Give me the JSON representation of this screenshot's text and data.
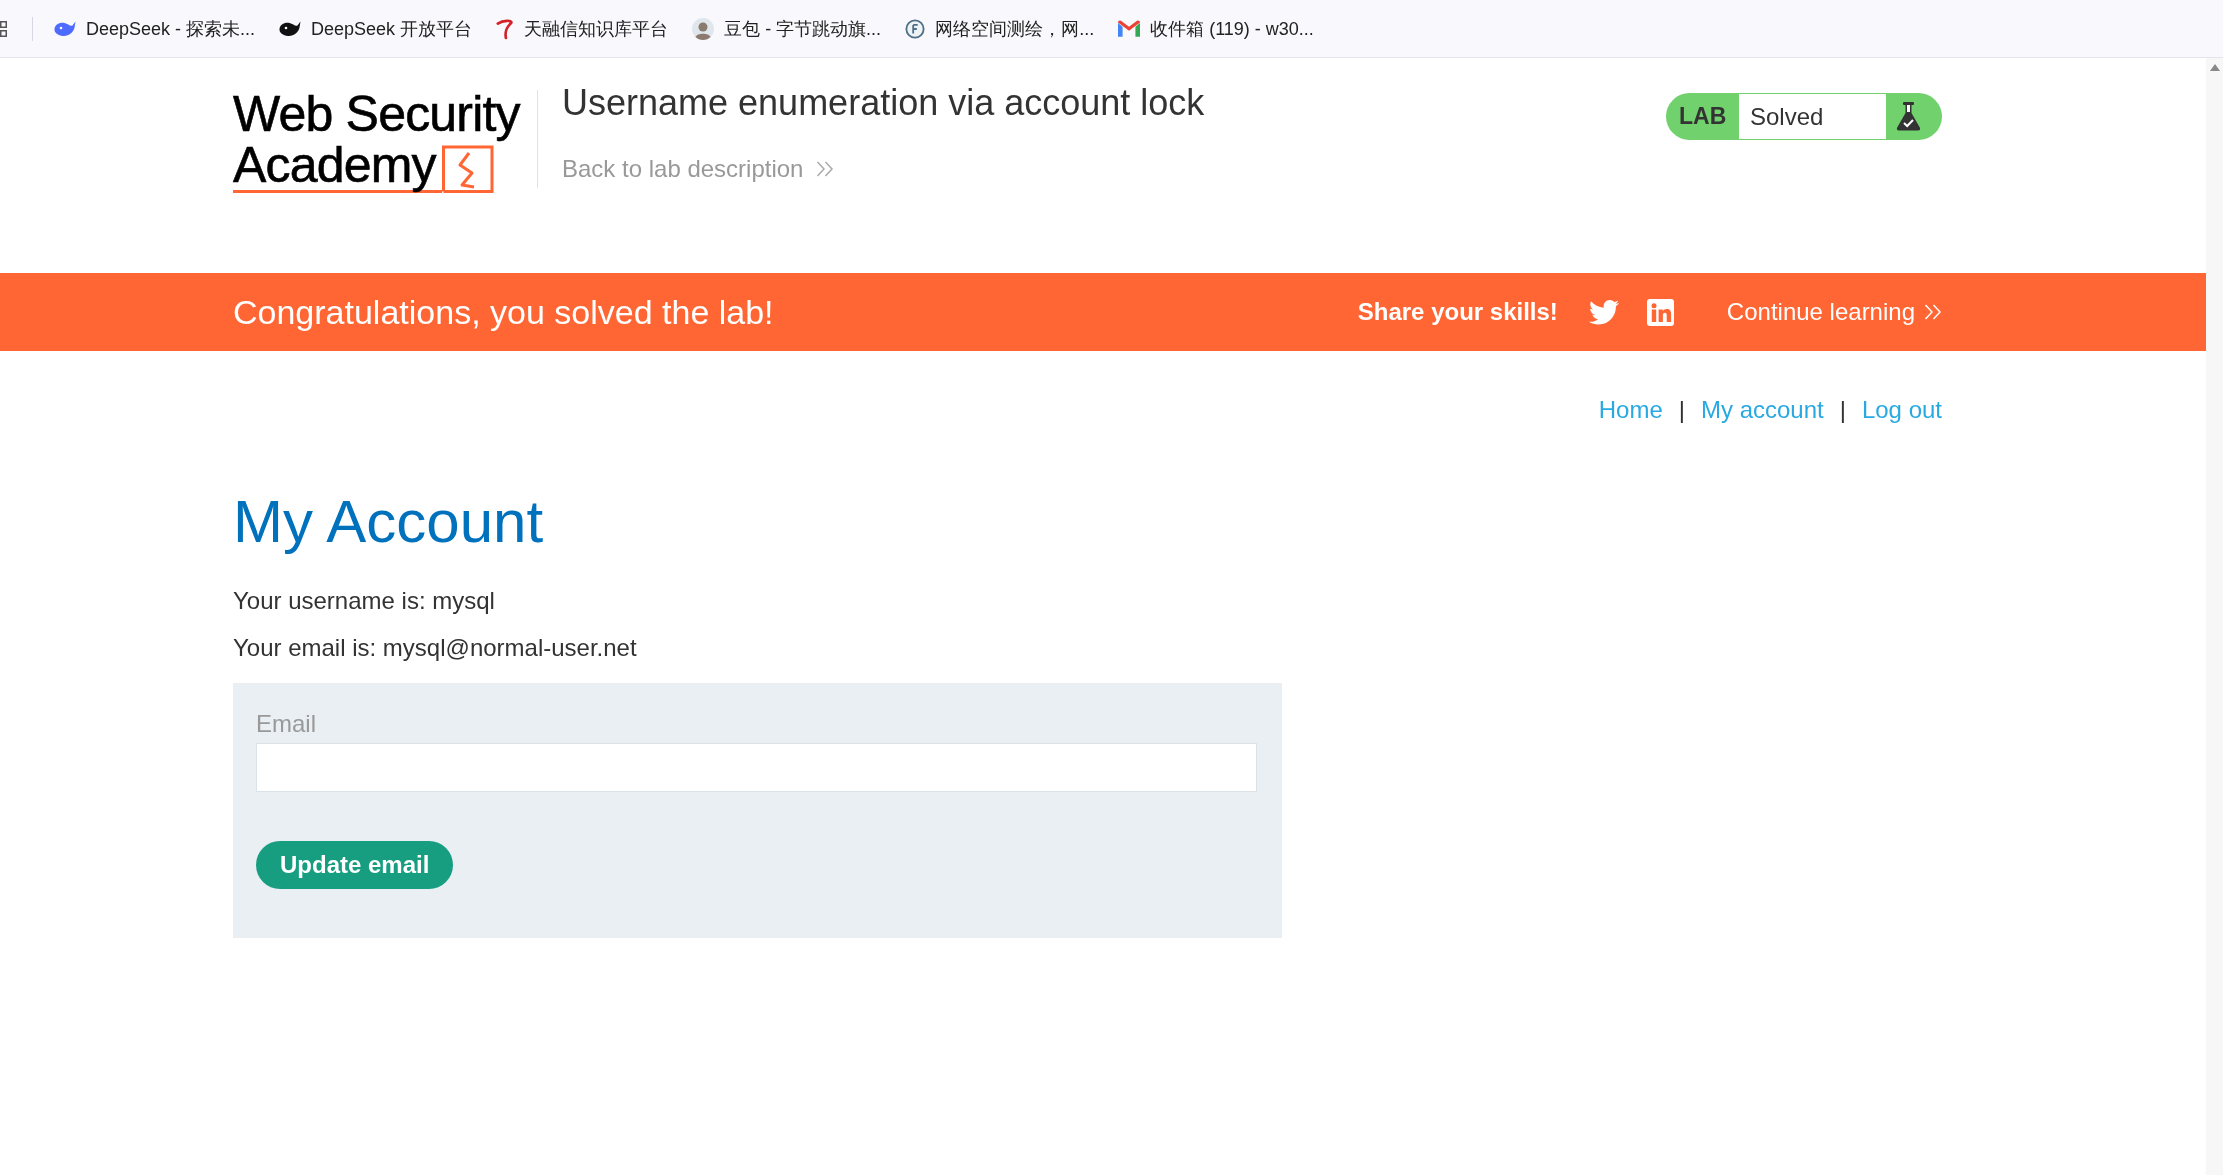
{
  "bookmarks_bar": {
    "items": [
      {
        "label": "DeepSeek - 探索未..."
      },
      {
        "label": "DeepSeek 开放平台"
      },
      {
        "label": "天融信知识库平台"
      },
      {
        "label": "豆包 - 字节跳动旗..."
      },
      {
        "label": "网络空间测绘，网..."
      },
      {
        "label": "收件箱 (119) - w30..."
      }
    ]
  },
  "header": {
    "logo": {
      "lines": [
        "Web Security",
        "Academy"
      ]
    },
    "title": "Username enumeration via account lock",
    "back_link": "Back to lab description",
    "lab_status": {
      "tag": "LAB",
      "status": "Solved"
    }
  },
  "banner": {
    "message": "Congratulations, you solved the lab!",
    "share_label": "Share your skills!",
    "continue_link": "Continue learning"
  },
  "nav": {
    "items": [
      {
        "kind": "link",
        "text": "Home"
      },
      {
        "kind": "separator",
        "text": "|"
      },
      {
        "kind": "link",
        "text": "My account"
      },
      {
        "kind": "separator",
        "text": "|"
      },
      {
        "kind": "link",
        "text": "Log out"
      }
    ]
  },
  "page": {
    "heading": "My Account",
    "lines": [
      "Your username is: mysql",
      "Your email is: mysql@normal-user.net"
    ]
  },
  "form": {
    "fields": [
      {
        "label": "Email"
      }
    ],
    "submit": "Update email"
  }
}
